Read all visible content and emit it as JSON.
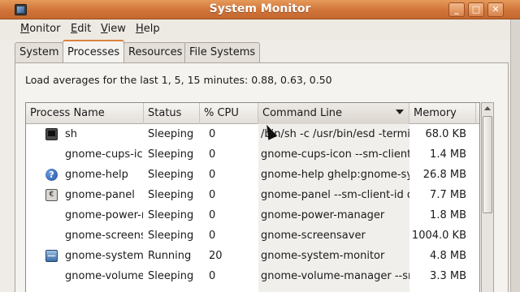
{
  "window": {
    "title": "System Monitor"
  },
  "menubar": [
    {
      "label": "Monitor",
      "mnemonic": "M",
      "rest": "onitor"
    },
    {
      "label": "Edit",
      "mnemonic": "E",
      "rest": "dit"
    },
    {
      "label": "View",
      "mnemonic": "V",
      "rest": "iew"
    },
    {
      "label": "Help",
      "mnemonic": "H",
      "rest": "elp"
    }
  ],
  "tabs": [
    "System",
    "Processes",
    "Resources",
    "File Systems"
  ],
  "active_tab": "Processes",
  "load_averages": "Load averages for the last 1, 5, 15 minutes: 0.88, 0.63, 0.50",
  "columns": [
    "Process Name",
    "Status",
    "% CPU",
    "Command Line",
    "Memory"
  ],
  "sorted_column": "Command Line",
  "rows": [
    {
      "icon": "terminal-icon",
      "name": "sh",
      "status": "Sleeping",
      "cpu": "0",
      "cmd": "/bin/sh -c /usr/bin/esd -terminate",
      "mem": "68.0 KB"
    },
    {
      "icon": "",
      "name": "gnome-cups-icon",
      "status": "Sleeping",
      "cpu": "0",
      "cmd": "gnome-cups-icon --sm-client-id",
      "mem": "1.4 MB"
    },
    {
      "icon": "help-icon",
      "name": "gnome-help",
      "status": "Sleeping",
      "cpu": "0",
      "cmd": "gnome-help ghelp:gnome-system",
      "mem": "26.8 MB"
    },
    {
      "icon": "panel-icon",
      "name": "gnome-panel",
      "status": "Sleeping",
      "cpu": "0",
      "cmd": "gnome-panel --sm-client-id d",
      "mem": "7.7 MB"
    },
    {
      "icon": "",
      "name": "gnome-power-manager",
      "status": "Sleeping",
      "cpu": "0",
      "cmd": "gnome-power-manager",
      "mem": "1.8 MB"
    },
    {
      "icon": "",
      "name": "gnome-screensaver",
      "status": "Sleeping",
      "cpu": "0",
      "cmd": "gnome-screensaver",
      "mem": "1004.0 KB"
    },
    {
      "icon": "system-monitor-icon",
      "name": "gnome-system-monitor",
      "status": "Running",
      "cpu": "20",
      "cmd": "gnome-system-monitor",
      "mem": "4.8 MB"
    },
    {
      "icon": "",
      "name": "gnome-volume-manager",
      "status": "Sleeping",
      "cpu": "0",
      "cmd": "gnome-volume-manager --sm",
      "mem": "3.3 MB"
    }
  ],
  "colors": {
    "titlebar": "#d0743a",
    "tab_highlight": "#d9823f"
  }
}
